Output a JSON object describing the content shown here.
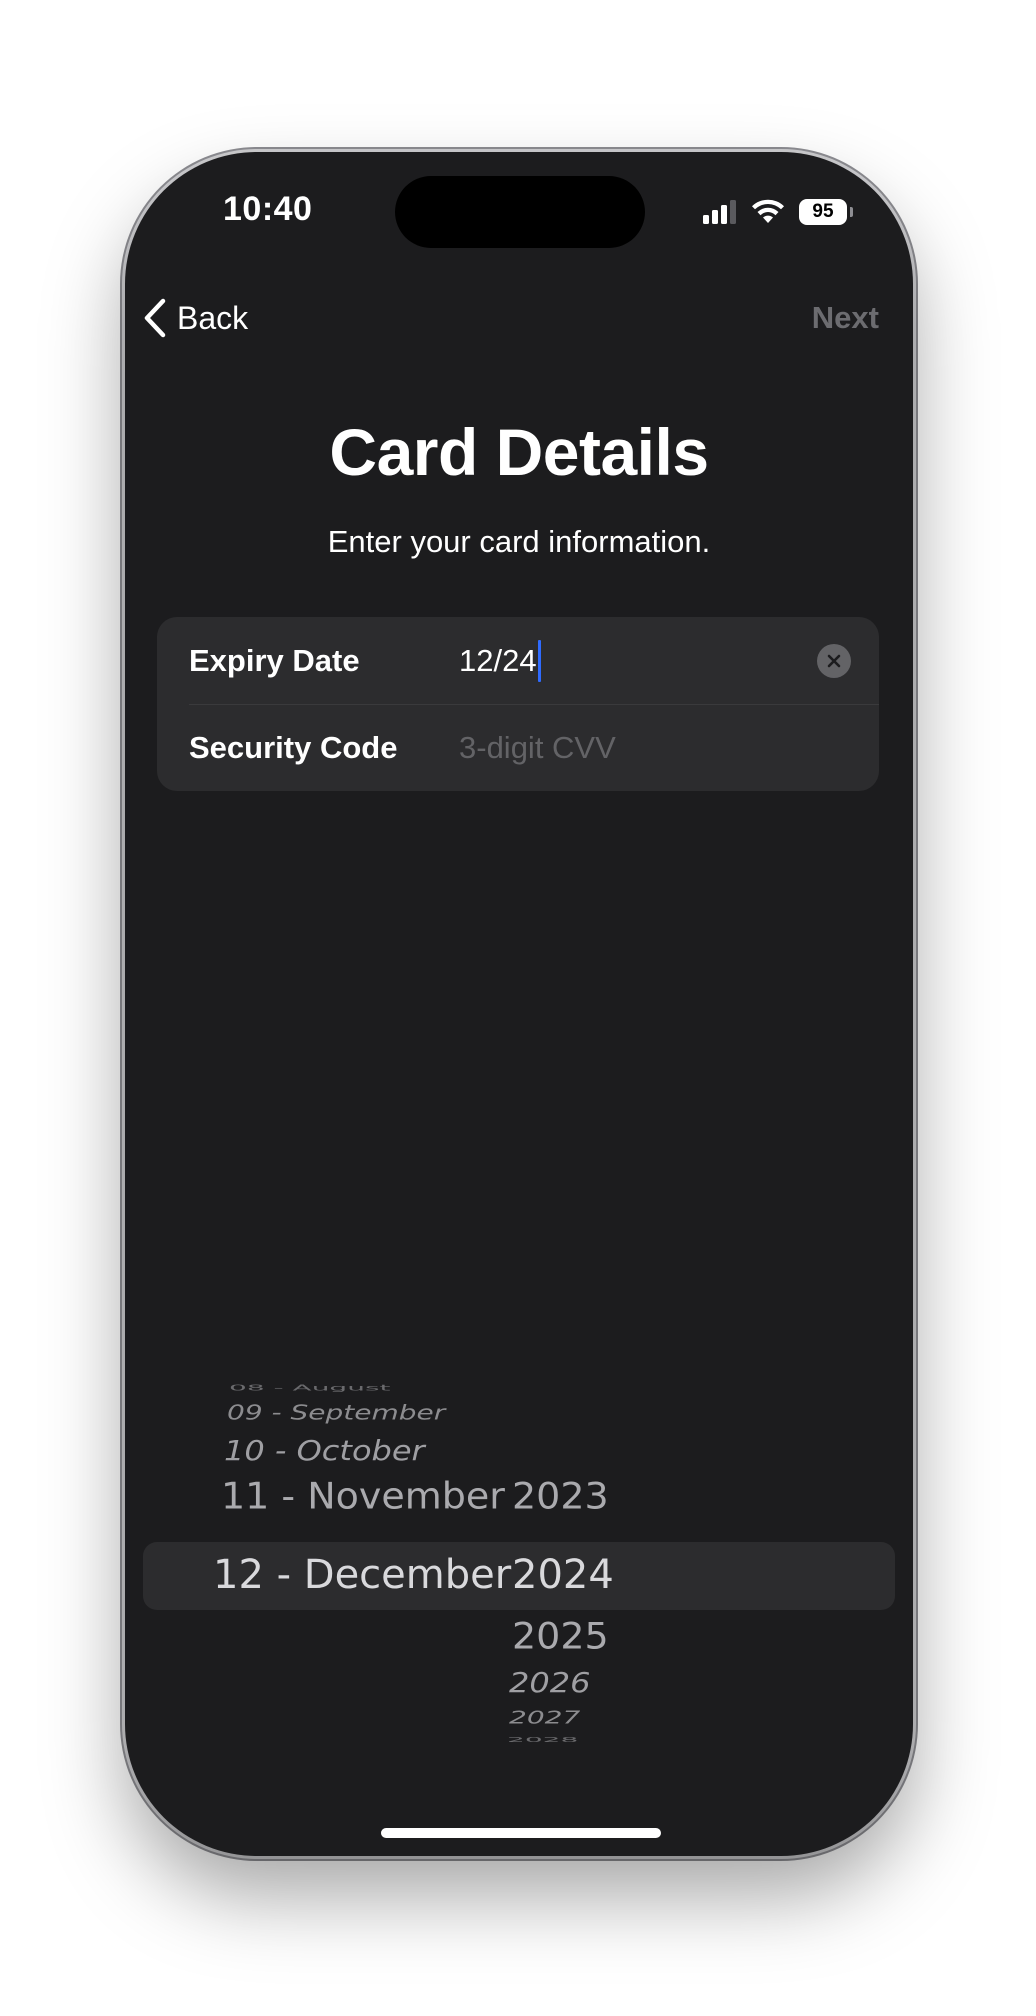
{
  "status_bar": {
    "time": "10:40",
    "battery": "95",
    "icons": [
      "cellular-signal-icon",
      "wifi-icon",
      "battery-icon"
    ]
  },
  "nav": {
    "back_label": "Back",
    "next_label": "Next"
  },
  "header": {
    "title": "Card Details",
    "subtitle": "Enter your card information."
  },
  "form": {
    "expiry": {
      "label": "Expiry Date",
      "value": "12/24"
    },
    "cvv": {
      "label": "Security Code",
      "placeholder": "3-digit CVV"
    }
  },
  "picker": {
    "months": [
      "08 - August",
      "09 - September",
      "10 - October",
      "11 - November",
      "12 - December"
    ],
    "years": [
      "2023",
      "2024",
      "2025",
      "2026",
      "2027",
      "2028"
    ],
    "selected_month": "12 - December",
    "selected_year": "2024"
  },
  "colors": {
    "background": "#1c1c1e",
    "card": "#2c2c2e",
    "caret": "#2f6bff",
    "disabled_text": "#6c6c70"
  }
}
